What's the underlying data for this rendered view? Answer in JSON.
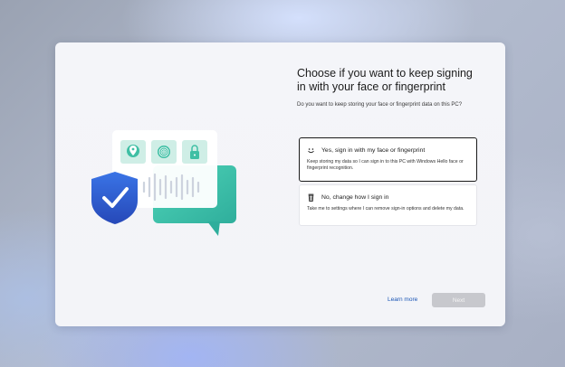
{
  "dialog": {
    "title": "Choose if you want to keep signing in with your face or fingerprint",
    "subtitle": "Do you want to keep storing your face or fingerprint data on this PC?",
    "options": [
      {
        "icon": "smiley-face-icon",
        "title": "Yes, sign in with my face or fingerprint",
        "description": "Keep storing my data so I can sign in to this PC with Windows Hello face or fingerprint recognition.",
        "selected": true
      },
      {
        "icon": "trash-can-icon",
        "title": "No, change how I sign in",
        "description": "Take me to settings where I can remove sign-in options and delete my data.",
        "selected": false
      }
    ],
    "learn_more": "Learn more",
    "next": "Next"
  },
  "illustration": {
    "tiles": [
      "face-scan-icon",
      "fingerprint-icon",
      "lock-icon"
    ],
    "shield": "shield-checkmark-icon"
  },
  "colors": {
    "accent_link": "#1a55b5",
    "shield_blue": "#2f63d8",
    "bubble_teal": "#3fc7b0",
    "next_disabled": "#c7c8cd"
  }
}
